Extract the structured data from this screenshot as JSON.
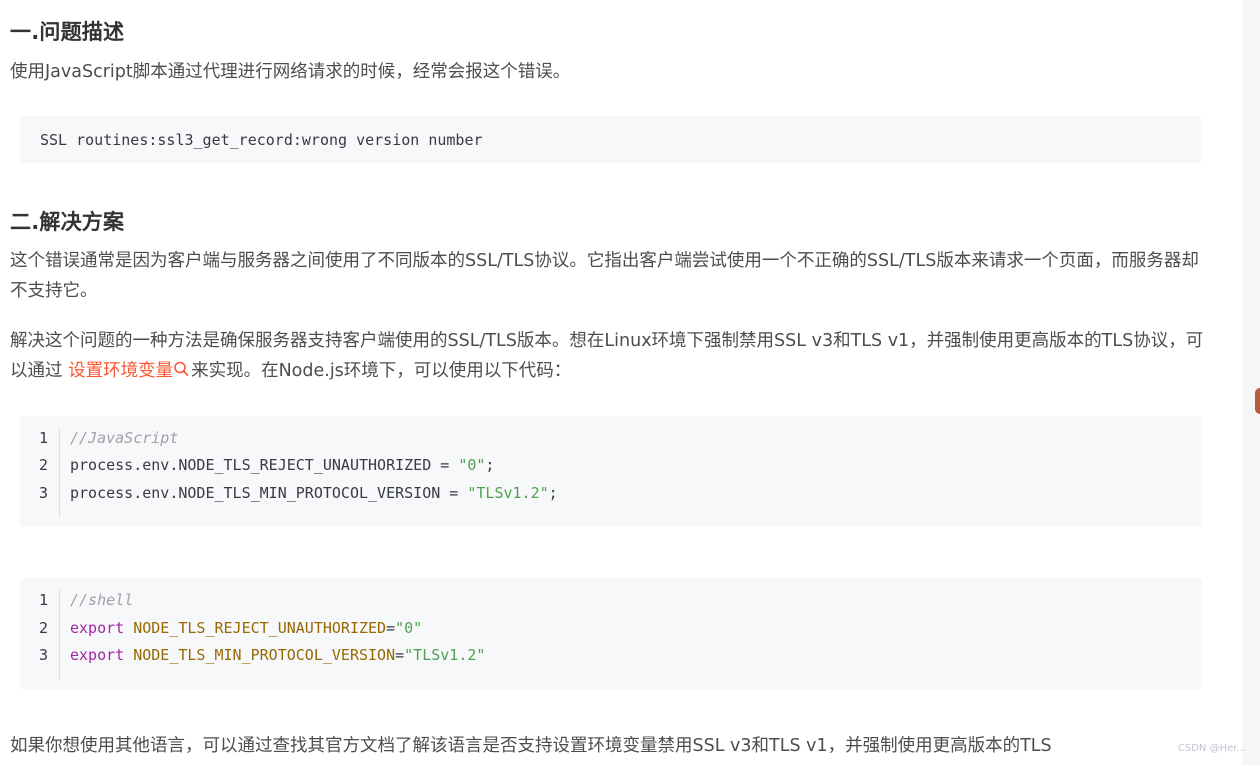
{
  "section1": {
    "heading": "一.问题描述",
    "paragraph": "使用JavaScript脚本通过代理进行网络请求的时候，经常会报这个错误。",
    "error_code": "SSL routines:ssl3_get_record:wrong version number"
  },
  "section2": {
    "heading": "二.解决方案",
    "paragraph1": "这个错误通常是因为客户端与服务器之间使用了不同版本的SSL/TLS协议。它指出客户端尝试使用一个不正确的SSL/TLS版本来请求一个页面，而服务器却不支持它。",
    "paragraph2_before": "解决这个问题的一种方法是确保服务器支持客户端使用的SSL/TLS版本。想在Linux环境下强制禁用SSL v3和TLS v1，并强制使用更高版本的TLS协议，可以通过 ",
    "paragraph2_link": "设置环境变量",
    "paragraph2_after": "来实现。在Node.js环境下，可以使用以下代码：",
    "paragraph3": "如果你想使用其他语言，可以通过查找其官方文档了解该语言是否支持设置环境变量禁用SSL v3和TLS v1，并强制使用更高版本的TLS"
  },
  "code_js": {
    "lines": [
      {
        "num": "1",
        "comment": "//JavaScript"
      },
      {
        "num": "2",
        "prefix": "process.env.NODE_TLS_REJECT_UNAUTHORIZED = ",
        "string": "\"0\"",
        "suffix": ";"
      },
      {
        "num": "3",
        "prefix": "process.env.NODE_TLS_MIN_PROTOCOL_VERSION = ",
        "string": "\"TLSv1.2\"",
        "suffix": ";"
      }
    ]
  },
  "code_shell": {
    "lines": [
      {
        "num": "1",
        "comment": "//shell"
      },
      {
        "num": "2",
        "keyword": "export",
        "var": "NODE_TLS_REJECT_UNAUTHORIZED",
        "eq": "=",
        "string": "\"0\""
      },
      {
        "num": "3",
        "keyword": "export",
        "var": "NODE_TLS_MIN_PROTOCOL_VERSION",
        "eq": "=",
        "string": "\"TLSv1.2\""
      }
    ]
  },
  "watermark": "CSDN @Her...",
  "colors": {
    "link": "#fc5531",
    "string": "#50a14f",
    "keyword": "#a626a4",
    "variable": "#986801",
    "comment": "#a0a1a7",
    "code_bg": "#f6f8fa"
  },
  "icons": {
    "link_search": "search-icon"
  }
}
